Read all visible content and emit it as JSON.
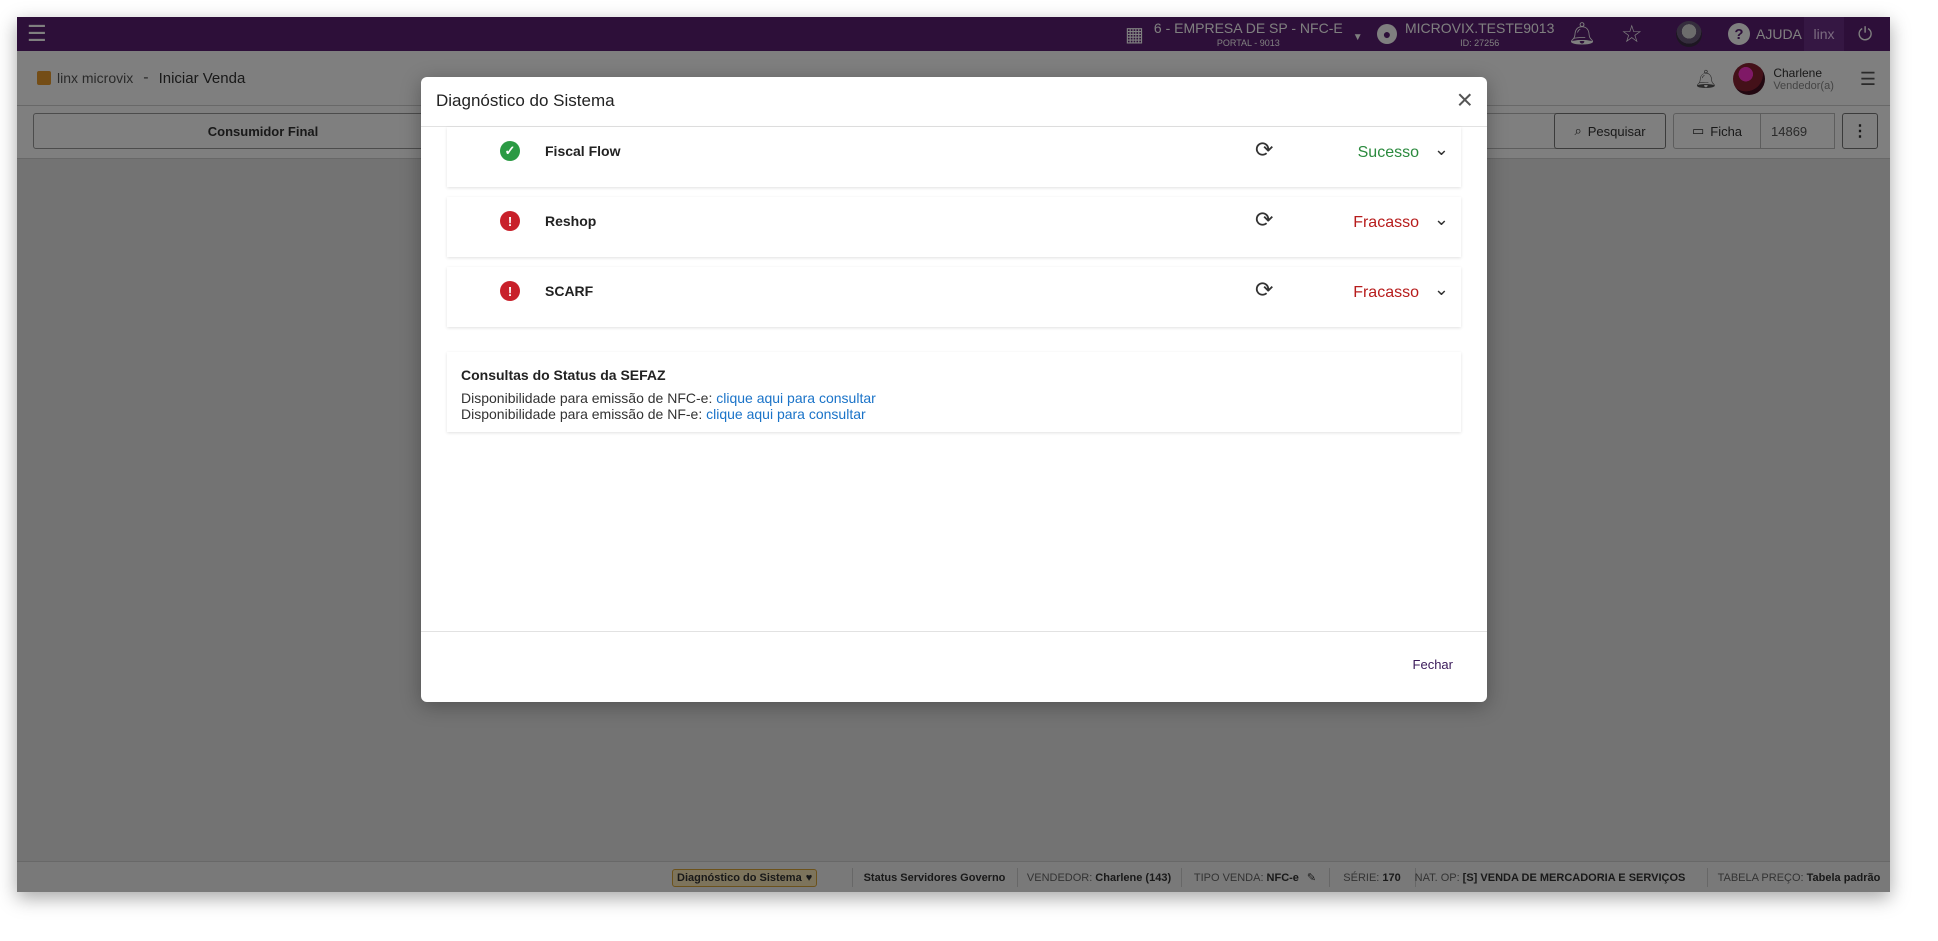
{
  "topbar": {
    "company_line1": "6 - EMPRESA DE SP - NFC-E",
    "company_line2": "PORTAL - 9013",
    "user_line1": "MICROVIX.TESTE9013",
    "user_line2": "ID: 27256",
    "help_label": "AJUDA",
    "logo_text": "linx",
    "icons": [
      "menu-icon",
      "building-icon",
      "account-icon",
      "bell-icon",
      "star-icon",
      "help-icon",
      "power-icon"
    ]
  },
  "header": {
    "brand": "linx microvix",
    "separator": "-",
    "page_title": "Iniciar Venda",
    "user_name": "Charlene",
    "user_role": "Vendedor(a)"
  },
  "toolbar": {
    "customer_button": "Consumidor Final",
    "search_button": "Pesquisar",
    "ficha_button": "Ficha",
    "ficha_number": "14869",
    "more_button": "⋮"
  },
  "statusbar": {
    "diagnostic": "Diagnóstico do Sistema",
    "gov_status": "Status Servidores Governo",
    "vendedor_label": "VENDEDOR:",
    "vendedor_value": "Charlene (143)",
    "tipo_label": "TIPO VENDA:",
    "tipo_value": "NFC-e",
    "serie_label": "SÉRIE:",
    "serie_value": "170",
    "natop_label": "NAT. OP:",
    "natop_value": "[S] VENDA DE MERCADORIA E SERVIÇOS",
    "tabela_label": "TABELA PREÇO:",
    "tabela_value": "Tabela padrão"
  },
  "modal": {
    "title": "Diagnóstico do Sistema",
    "close": "×",
    "services": [
      {
        "name": "Fiscal Flow",
        "status": "Sucesso",
        "state": "ok"
      },
      {
        "name": "Reshop",
        "status": "Fracasso",
        "state": "err"
      },
      {
        "name": "SCARF",
        "status": "Fracasso",
        "state": "err"
      }
    ],
    "sefaz": {
      "title": "Consultas do Status da SEFAZ",
      "nfce_text": "Disponibilidade para emissão de NFC-e:",
      "nfce_link": "clique aqui para consultar",
      "nfe_text": "Disponibilidade para emissão de NF-e:",
      "nfe_link": "clique aqui para consultar"
    },
    "footer_button": "Fechar"
  },
  "colors": {
    "topbar": "#5b1f72",
    "success": "#2b8a3e",
    "failure": "#b71c1c",
    "link": "#1a73c8"
  }
}
